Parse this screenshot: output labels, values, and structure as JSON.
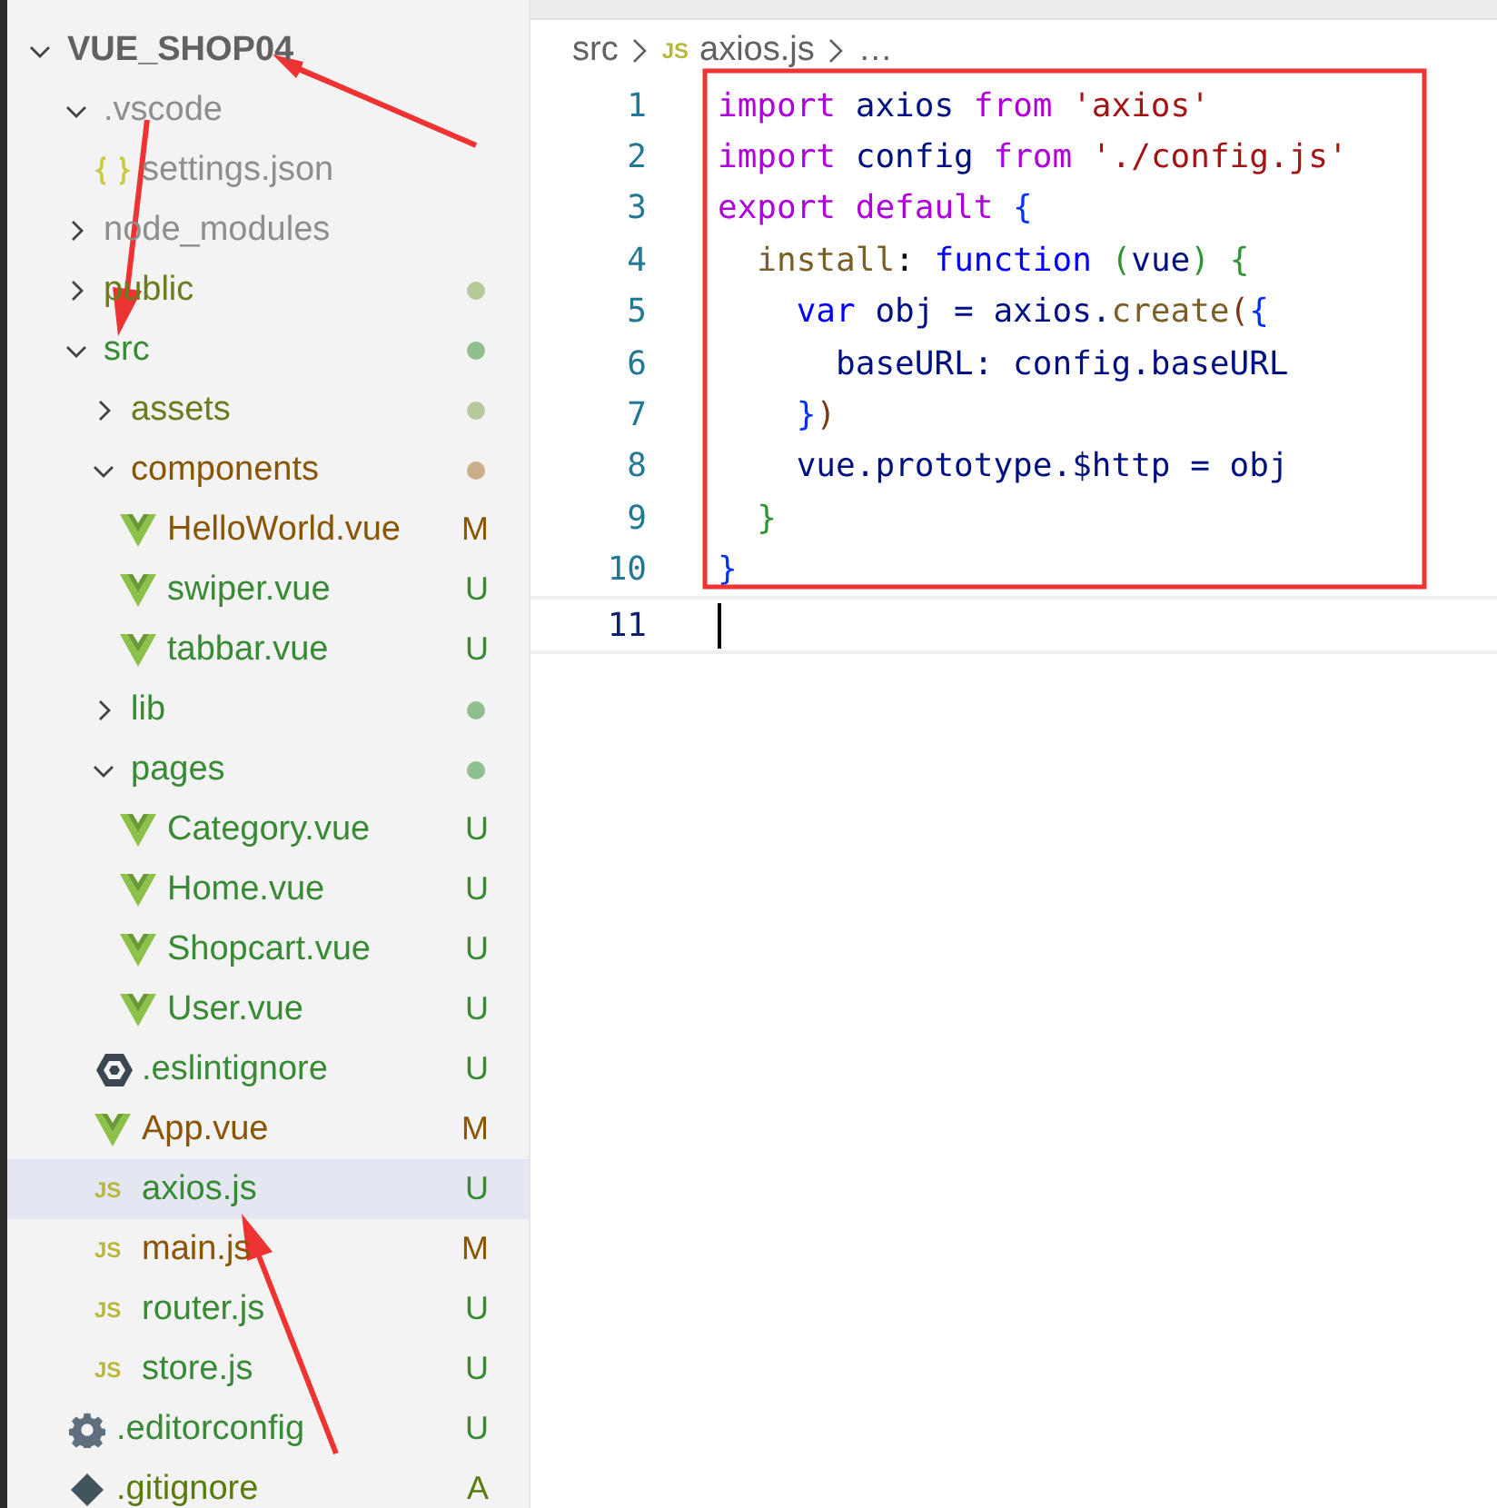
{
  "explorer": {
    "root": {
      "label": "VUE_SHOP04",
      "expanded": true,
      "children": [
        {
          "label": ".vscode",
          "kind": "folder",
          "expanded": true,
          "color": "#8e8e90",
          "selected": false,
          "children": [
            {
              "label": "settings.json",
              "kind": "json",
              "color": "#8e8e90",
              "selected": false
            }
          ]
        },
        {
          "label": "node_modules",
          "kind": "folder",
          "expanded": false,
          "color": "#8e8e90",
          "selected": false
        },
        {
          "label": "public",
          "kind": "folder",
          "expanded": false,
          "color": "#6c7b1e",
          "dot": {
            "color": "#b5c99a"
          },
          "selected": false
        },
        {
          "label": "src",
          "kind": "folder",
          "expanded": true,
          "color": "#388a34",
          "dot": {
            "color": "#8fbf8f"
          },
          "selected": false,
          "children": [
            {
              "label": "assets",
              "kind": "folder",
              "expanded": false,
              "color": "#6c7b1e",
              "dot": {
                "color": "#b5c99a"
              },
              "selected": false
            },
            {
              "label": "components",
              "kind": "folder",
              "expanded": true,
              "color": "#895503",
              "dot": {
                "color": "#c9ae8a"
              },
              "selected": false,
              "children": [
                {
                  "label": "HelloWorld.vue",
                  "kind": "vue",
                  "color": "#895503",
                  "badge": "M",
                  "selected": false
                },
                {
                  "label": "swiper.vue",
                  "kind": "vue",
                  "color": "#388a34",
                  "badge": "U",
                  "selected": false
                },
                {
                  "label": "tabbar.vue",
                  "kind": "vue",
                  "color": "#388a34",
                  "badge": "U",
                  "selected": false
                }
              ]
            },
            {
              "label": "lib",
              "kind": "folder",
              "expanded": false,
              "color": "#388a34",
              "dot": {
                "color": "#8fbf8f"
              },
              "selected": false
            },
            {
              "label": "pages",
              "kind": "folder",
              "expanded": true,
              "color": "#388a34",
              "dot": {
                "color": "#8fbf8f"
              },
              "selected": false,
              "children": [
                {
                  "label": "Category.vue",
                  "kind": "vue",
                  "color": "#388a34",
                  "badge": "U",
                  "selected": false
                },
                {
                  "label": "Home.vue",
                  "kind": "vue",
                  "color": "#388a34",
                  "badge": "U",
                  "selected": false
                },
                {
                  "label": "Shopcart.vue",
                  "kind": "vue",
                  "color": "#388a34",
                  "badge": "U",
                  "selected": false
                },
                {
                  "label": "User.vue",
                  "kind": "vue",
                  "color": "#388a34",
                  "badge": "U",
                  "selected": false
                }
              ]
            },
            {
              "label": ".eslintignore",
              "kind": "eslint",
              "color": "#388a34",
              "badge": "U",
              "selected": false
            },
            {
              "label": "App.vue",
              "kind": "vue",
              "color": "#895503",
              "badge": "M",
              "selected": false
            },
            {
              "label": "axios.js",
              "kind": "js",
              "icon": "JS",
              "color": "#388a34",
              "badge": "U",
              "selected": true
            },
            {
              "label": "main.js",
              "kind": "js",
              "icon": "JS",
              "color": "#895503",
              "badge": "M",
              "selected": false
            },
            {
              "label": "router.js",
              "kind": "js",
              "icon": "JS",
              "color": "#388a34",
              "badge": "U",
              "selected": false
            },
            {
              "label": "store.js",
              "kind": "js",
              "icon": "JS",
              "color": "#388a34",
              "badge": "U",
              "selected": false
            }
          ]
        },
        {
          "label": ".editorconfig",
          "kind": "gear",
          "color": "#388a34",
          "badge": "U",
          "selected": false
        },
        {
          "label": ".gitignore",
          "kind": "git",
          "color": "#587c0c",
          "badge": "A",
          "selected": false
        }
      ]
    }
  },
  "breadcrumbs": [
    {
      "label": "src",
      "kind": "folder"
    },
    {
      "label": "axios.js",
      "kind": "js",
      "icon": "JS"
    },
    {
      "label": "…",
      "kind": "more"
    }
  ],
  "editor": {
    "lines": [
      {
        "number": "1",
        "tokens": [
          {
            "t": "import",
            "color": "#af00db"
          },
          {
            "t": " axios ",
            "color": "#001080"
          },
          {
            "t": "from",
            "color": "#af00db"
          },
          {
            "t": " 'axios'",
            "color": "#a31515"
          }
        ]
      },
      {
        "number": "2",
        "tokens": [
          {
            "t": "import",
            "color": "#af00db"
          },
          {
            "t": " config ",
            "color": "#001080"
          },
          {
            "t": "from",
            "color": "#af00db"
          },
          {
            "t": " './config.js'",
            "color": "#a31515"
          }
        ]
      },
      {
        "number": "3",
        "tokens": [
          {
            "t": "export default",
            "color": "#af00db"
          },
          {
            "t": " {",
            "color": "#0431fa"
          }
        ]
      },
      {
        "number": "4",
        "tokens": [
          {
            "t": "  install",
            "color": "#795e26"
          },
          {
            "t": ": ",
            "color": "#000000"
          },
          {
            "t": "function",
            "color": "#0000ff"
          },
          {
            "t": " (",
            "color": "#319331"
          },
          {
            "t": "vue",
            "color": "#001080"
          },
          {
            "t": ") {",
            "color": "#319331"
          }
        ]
      },
      {
        "number": "5",
        "tokens": [
          {
            "t": "    var",
            "color": "#0000ff"
          },
          {
            "t": " obj = axios.",
            "color": "#001080"
          },
          {
            "t": "create",
            "color": "#795e26"
          },
          {
            "t": "(",
            "color": "#7b3814"
          },
          {
            "t": "{",
            "color": "#0431fa"
          }
        ]
      },
      {
        "number": "6",
        "tokens": [
          {
            "t": "      baseURL: config.baseURL",
            "color": "#001080"
          }
        ]
      },
      {
        "number": "7",
        "tokens": [
          {
            "t": "    }",
            "color": "#0431fa"
          },
          {
            "t": ")",
            "color": "#7b3814"
          }
        ]
      },
      {
        "number": "8",
        "tokens": [
          {
            "t": "    vue.prototype.$http = obj",
            "color": "#001080"
          }
        ]
      },
      {
        "number": "9",
        "tokens": [
          {
            "t": "  }",
            "color": "#319331"
          }
        ]
      },
      {
        "number": "10",
        "tokens": [
          {
            "t": "}",
            "color": "#0431fa"
          }
        ]
      },
      {
        "number": "11",
        "current": true
      }
    ]
  }
}
